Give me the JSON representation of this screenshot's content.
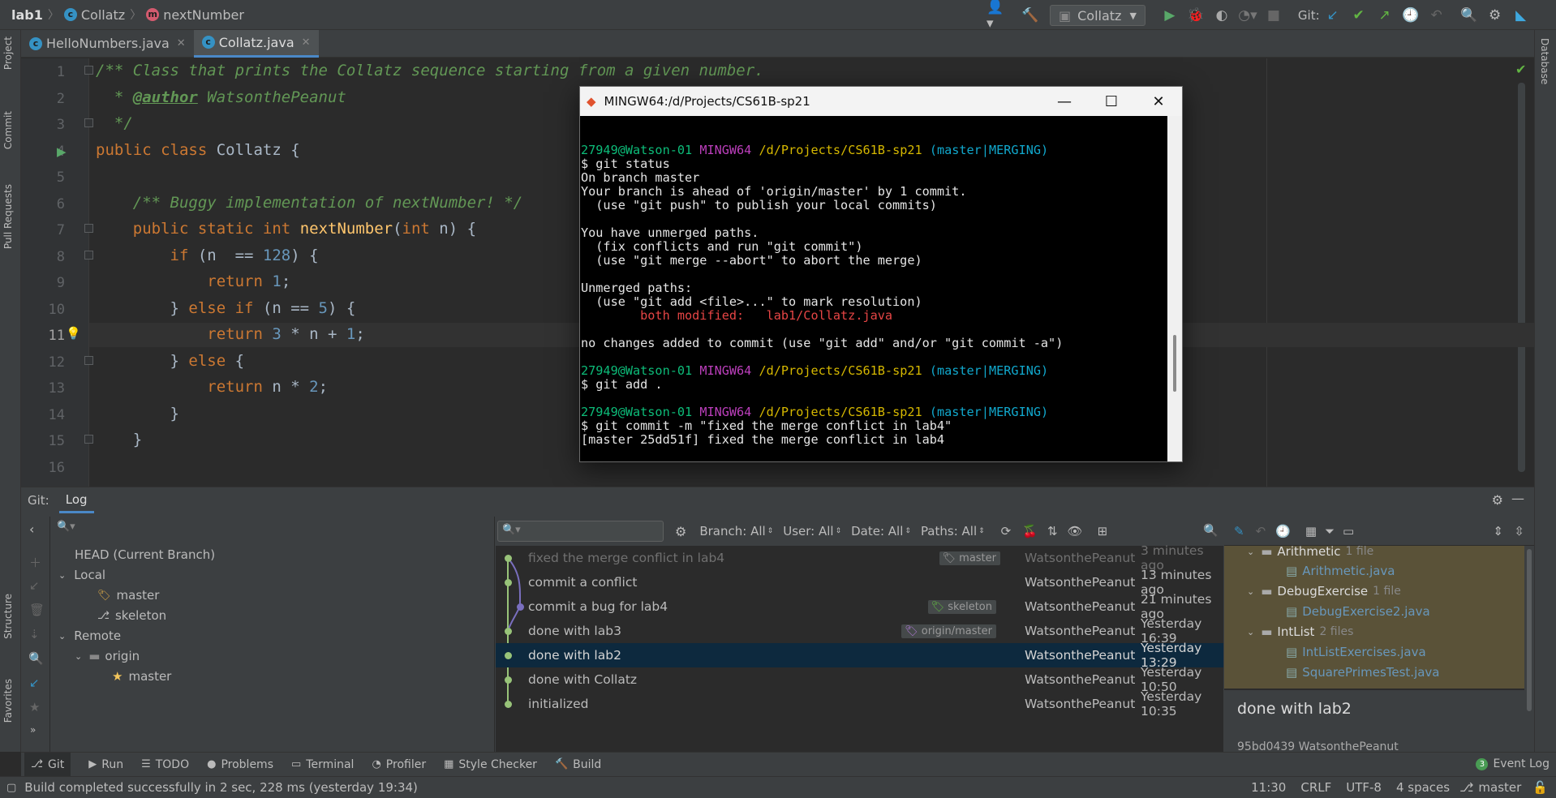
{
  "breadcrumb": {
    "project": "lab1",
    "class": "Collatz",
    "method": "nextNumber"
  },
  "toolbar": {
    "run_config": "Collatz",
    "git_label": "Git:"
  },
  "left_strip": {
    "project": "Project",
    "commit": "Commit",
    "pull_requests": "Pull Requests",
    "structure": "Structure",
    "favorites": "Favorites"
  },
  "right_strip": {
    "database": "Database"
  },
  "tabs": [
    {
      "label": "HelloNumbers.java"
    },
    {
      "label": "Collatz.java"
    }
  ],
  "editor": {
    "line_numbers": [
      "1",
      "2",
      "3",
      "4",
      "5",
      "6",
      "7",
      "8",
      "9",
      "10",
      "11",
      "12",
      "13",
      "14",
      "15",
      "16"
    ],
    "current_line": "11"
  },
  "terminal": {
    "title": "MINGW64:/d/Projects/CS61B-sp21",
    "user": "27949@Watson-01",
    "shell": "MINGW64",
    "path": "/d/Projects/CS61B-sp21",
    "branch": "master",
    "merging": "MERGING",
    "lines": {
      "cmd1": "$ git status",
      "l1": "On branch master",
      "l2": "Your branch is ahead of 'origin/master' by 1 commit.",
      "l3": "  (use \"git push\" to publish your local commits)",
      "l4": "You have unmerged paths.",
      "l5": "  (fix conflicts and run \"git commit\")",
      "l6": "  (use \"git merge --abort\" to abort the merge)",
      "l7": "Unmerged paths:",
      "l8": "  (use \"git add <file>...\" to mark resolution)",
      "l9": "        both modified:   lab1/Collatz.java",
      "l10": "no changes added to commit (use \"git add\" and/or \"git commit -a\")",
      "cmd2": "$ git add .",
      "cmd3": "$ git commit -m \"fixed the merge conflict in lab4\"",
      "l11": "[master 25dd51f] fixed the merge conflict in lab4"
    }
  },
  "git_panel": {
    "title": "Git:",
    "tab": "Log",
    "filters": {
      "branch": "Branch: All",
      "user": "User: All",
      "date": "Date: All",
      "paths": "Paths: All"
    },
    "tree": {
      "head": "HEAD (Current Branch)",
      "local": "Local",
      "local_branches": [
        "master",
        "skeleton"
      ],
      "remote": "Remote",
      "origin": "origin",
      "origin_master": "master"
    },
    "commits": [
      {
        "message": "fixed the merge conflict in lab4",
        "badge": "master",
        "author": "WatsonthePeanut",
        "date": "3 minutes ago"
      },
      {
        "message": "commit a conflict",
        "badge": "",
        "author": "WatsonthePeanut",
        "date": "13 minutes ago"
      },
      {
        "message": "commit a bug for lab4",
        "badge": "skeleton",
        "author": "WatsonthePeanut",
        "date": "21 minutes ago"
      },
      {
        "message": "done with lab3",
        "badge": "origin/master",
        "author": "WatsonthePeanut",
        "date": "Yesterday 16:39"
      },
      {
        "message": "done with lab2",
        "badge": "",
        "author": "WatsonthePeanut",
        "date": "Yesterday 13:29"
      },
      {
        "message": "done with Collatz",
        "badge": "",
        "author": "WatsonthePeanut",
        "date": "Yesterday 10:50"
      },
      {
        "message": "initialized",
        "badge": "",
        "author": "WatsonthePeanut",
        "date": "Yesterday 10:35"
      }
    ],
    "changes": {
      "folders": [
        {
          "name": "Arithmetic",
          "count": "1 file",
          "files": [
            "Arithmetic.java"
          ]
        },
        {
          "name": "DebugExercise",
          "count": "1 file",
          "files": [
            "DebugExercise2.java"
          ]
        },
        {
          "name": "IntList",
          "count": "2 files",
          "files": [
            "IntListExercises.java",
            "SquarePrimesTest.java"
          ]
        }
      ]
    },
    "detail": {
      "message": "done with lab2",
      "meta": "95bd0439 WatsonthePeanut"
    }
  },
  "bottom_tools": [
    "Git",
    "Run",
    "TODO",
    "Problems",
    "Terminal",
    "Profiler",
    "Style Checker",
    "Build"
  ],
  "event_log": {
    "count": "3",
    "label": "Event Log"
  },
  "status": {
    "message": "Build completed successfully in 2 sec, 228 ms (yesterday 19:34)",
    "position": "11:30",
    "line_sep": "CRLF",
    "encoding": "UTF-8",
    "indent": "4 spaces",
    "branch": "master"
  }
}
